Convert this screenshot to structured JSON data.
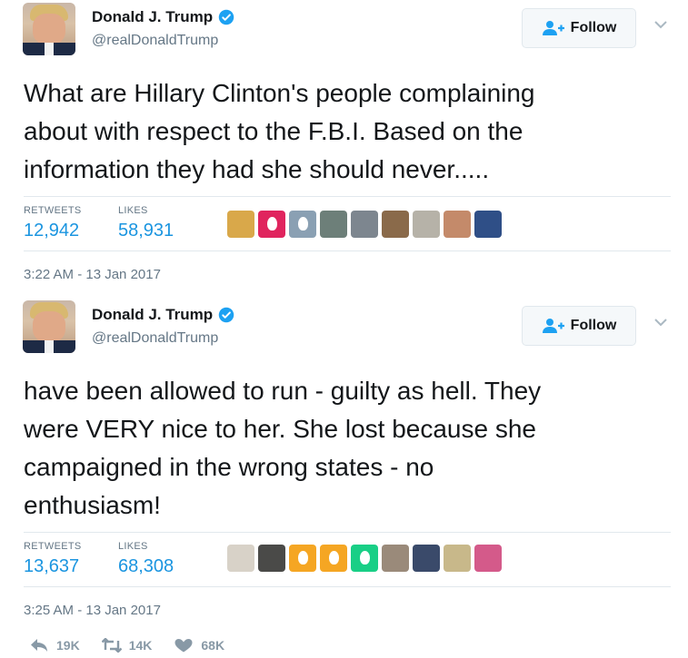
{
  "tweets": [
    {
      "author": {
        "name": "Donald J. Trump",
        "handle": "@realDonaldTrump"
      },
      "follow_label": "Follow",
      "text": "What are Hillary Clinton's people complaining\nabout with respect to the F.B.I. Based on the\ninformation they had she should never.....",
      "stats": {
        "retweets_label": "RETWEETS",
        "retweets": "12,942",
        "likes_label": "LIKES",
        "likes": "58,931"
      },
      "liker_avatar_colors": [
        "#d9a84a",
        "#e0245e",
        "#8aa0b3",
        "#6d7f79",
        "#7d868f",
        "#8a6a4a",
        "#b6b2a8",
        "#c48a6a",
        "#2f4f87"
      ],
      "timestamp": "3:22 AM - 13 Jan 2017"
    },
    {
      "author": {
        "name": "Donald J. Trump",
        "handle": "@realDonaldTrump"
      },
      "follow_label": "Follow",
      "text": "have been allowed to run - guilty as hell. They\nwere VERY nice to her. She lost because she\ncampaigned in the wrong states - no\nenthusiasm!",
      "stats": {
        "retweets_label": "RETWEETS",
        "retweets": "13,637",
        "likes_label": "LIKES",
        "likes": "68,308"
      },
      "liker_avatar_colors": [
        "#d8d2c8",
        "#4a4a48",
        "#f5a623",
        "#f5a623",
        "#19cf86",
        "#9a8a7a",
        "#3a4a6a",
        "#c8b88a",
        "#d45a8a"
      ],
      "timestamp": "3:25 AM - 13 Jan 2017"
    }
  ],
  "actions": {
    "reply_count": "19K",
    "retweet_count": "14K",
    "like_count": "68K"
  },
  "colors": {
    "link_blue": "#1b95e0",
    "muted": "#657786",
    "verified": "#1da1f2"
  },
  "icons": [
    "verified-badge-icon",
    "follow-user-icon",
    "chevron-down-icon",
    "reply-icon",
    "retweet-icon",
    "heart-icon"
  ]
}
